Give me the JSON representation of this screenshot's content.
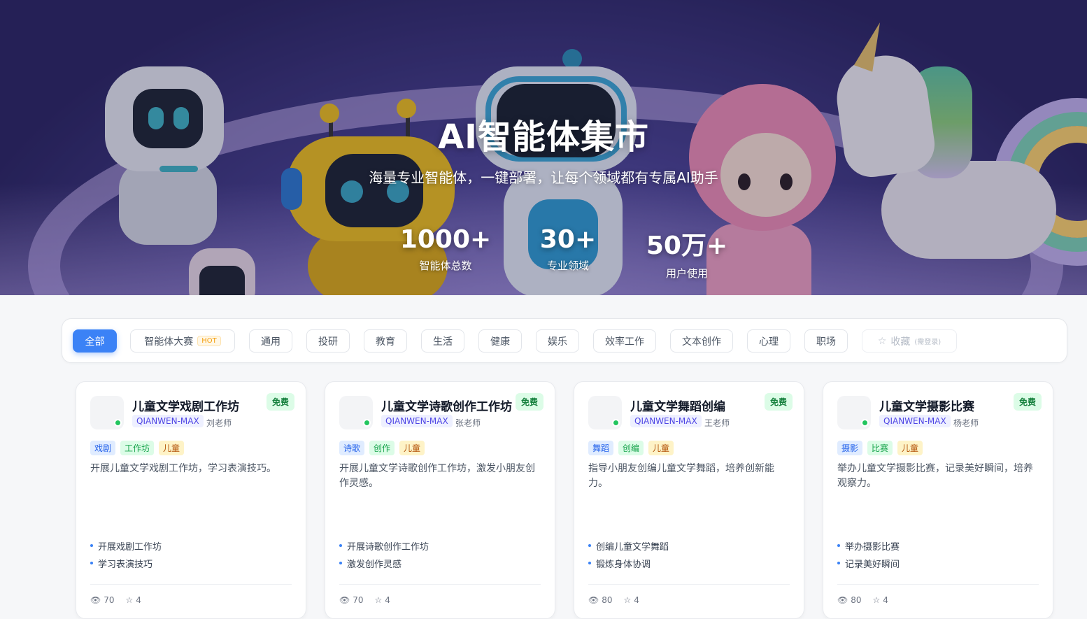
{
  "hero": {
    "title": "AI智能体集市",
    "subtitle": "海量专业智能体，一键部署，让每个领域都有专属AI助手",
    "stats": [
      {
        "value": "1000+",
        "label": "智能体总数"
      },
      {
        "value": "30+",
        "label": "专业领域"
      },
      {
        "value": "50万+",
        "label": "用户使用"
      }
    ]
  },
  "filters": {
    "all": "全部",
    "contest": "智能体大赛",
    "hot_badge": "HOT",
    "general": "通用",
    "research": "投研",
    "education": "教育",
    "life": "生活",
    "health": "健康",
    "entertainment": "娱乐",
    "efficiency": "效率工作",
    "writing": "文本创作",
    "psychology": "心理",
    "career": "职场",
    "favorites": "收藏",
    "login_hint": "(需登录)"
  },
  "colors": {
    "accent": "#3b82f6",
    "online": "#22c55e",
    "free_badge": "#15803d"
  },
  "cards": [
    {
      "title": "儿童文学戏剧工作坊",
      "badge": "免费",
      "model": "QIANWEN-MAX",
      "author": "刘老师",
      "tags": [
        "戏剧",
        "工作坊",
        "儿童"
      ],
      "desc": "开展儿童文学戏剧工作坊，学习表演技巧。",
      "features": [
        "开展戏剧工作坊",
        "学习表演技巧"
      ],
      "views": "70",
      "stars": "4"
    },
    {
      "title": "儿童文学诗歌创作工作坊",
      "badge": "免费",
      "model": "QIANWEN-MAX",
      "author": "张老师",
      "tags": [
        "诗歌",
        "创作",
        "儿童"
      ],
      "desc": "开展儿童文学诗歌创作工作坊，激发小朋友创作灵感。",
      "features": [
        "开展诗歌创作工作坊",
        "激发创作灵感"
      ],
      "views": "70",
      "stars": "4"
    },
    {
      "title": "儿童文学舞蹈创编",
      "badge": "免费",
      "model": "QIANWEN-MAX",
      "author": "王老师",
      "tags": [
        "舞蹈",
        "创编",
        "儿童"
      ],
      "desc": "指导小朋友创编儿童文学舞蹈，培养创新能力。",
      "features": [
        "创编儿童文学舞蹈",
        "锻炼身体协调"
      ],
      "views": "80",
      "stars": "4"
    },
    {
      "title": "儿童文学摄影比赛",
      "badge": "免费",
      "model": "QIANWEN-MAX",
      "author": "杨老师",
      "tags": [
        "摄影",
        "比赛",
        "儿童"
      ],
      "desc": "举办儿童文学摄影比赛，记录美好瞬间，培养观察力。",
      "features": [
        "举办摄影比赛",
        "记录美好瞬间"
      ],
      "views": "80",
      "stars": "4"
    }
  ]
}
